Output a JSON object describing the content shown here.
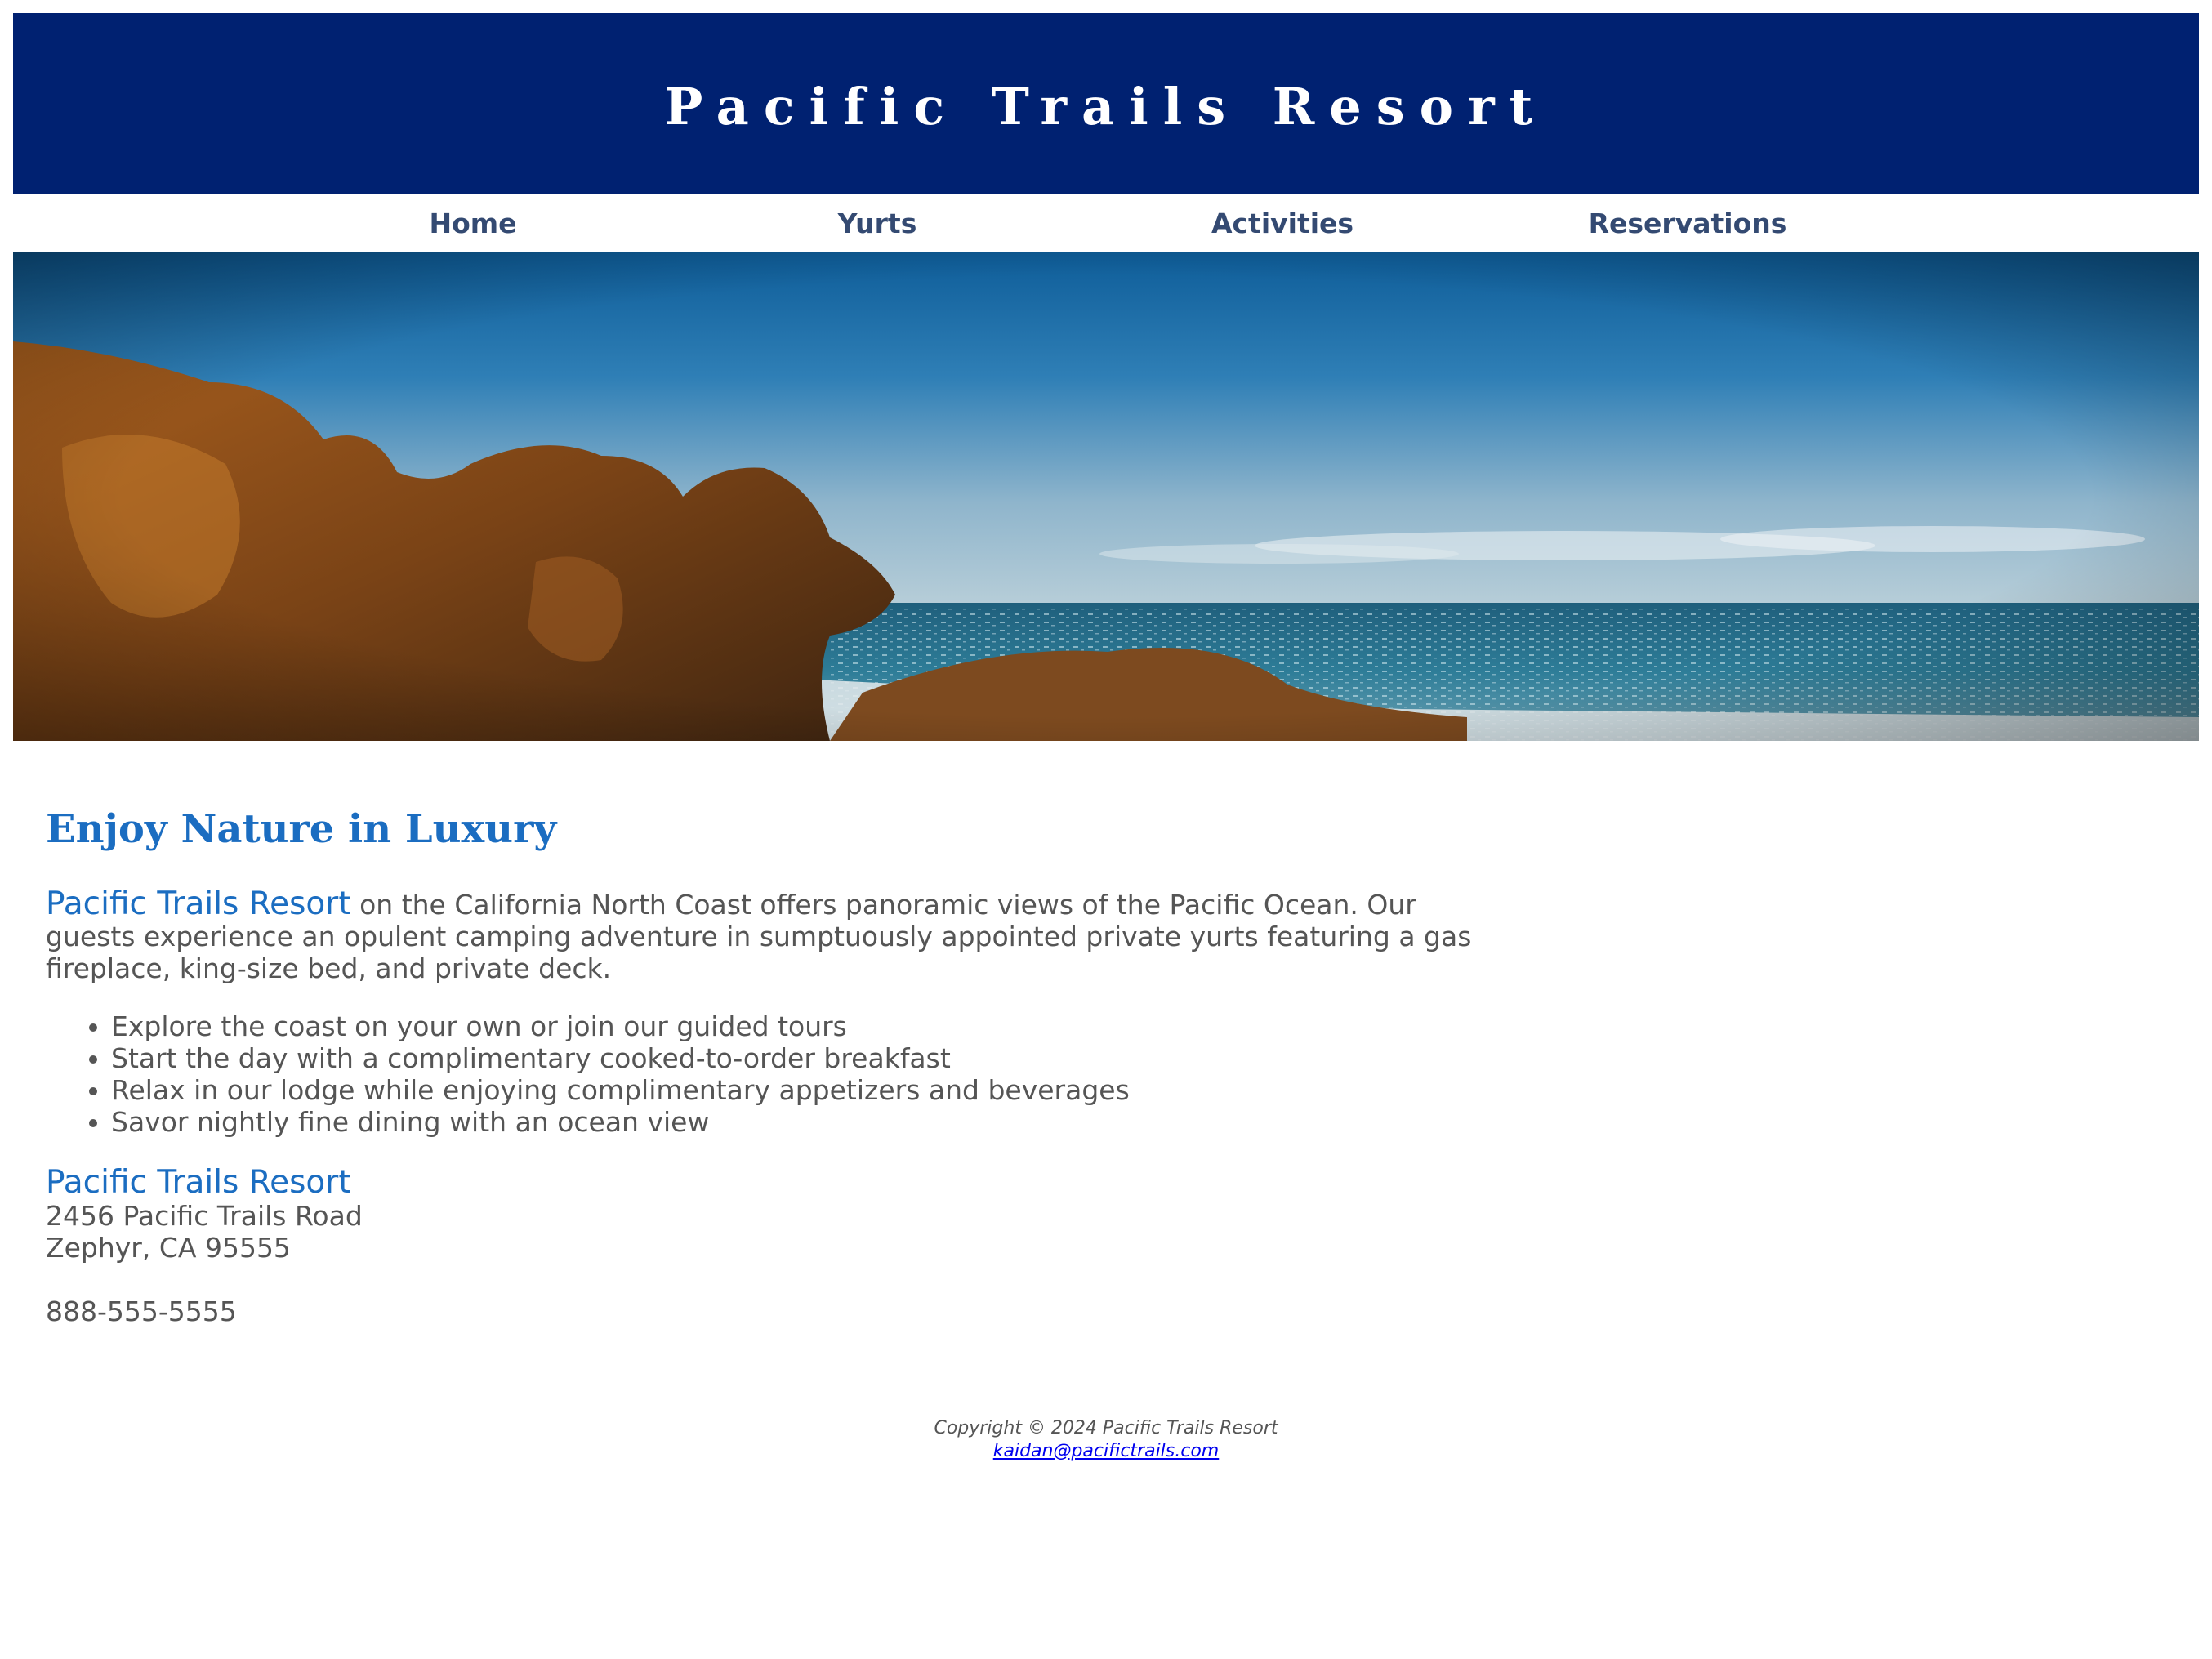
{
  "header": {
    "title": "Pacific Trails Resort"
  },
  "nav": {
    "items": [
      {
        "label": "Home"
      },
      {
        "label": "Yurts"
      },
      {
        "label": "Activities"
      },
      {
        "label": "Reservations"
      }
    ]
  },
  "colors": {
    "banner": "#002171",
    "accent": "#1b6dc1",
    "nav_text": "#344a72",
    "body_text": "#555555"
  },
  "main": {
    "headline": "Enjoy Nature in Luxury",
    "intro": {
      "resort_name": "Pacific Trails Resort",
      "text": " on the California North Coast offers panoramic views of the Pacific Ocean. Our guests experience an opulent camping adventure in sumptuously appointed private yurts featuring a gas fireplace, king-size bed, and private deck."
    },
    "features": [
      "Explore the coast on your own or join our guided tours",
      "Start the day with a complimentary cooked-to-order breakfast",
      "Relax in our lodge while enjoying complimentary appetizers and beverages",
      "Savor nightly fine dining with an ocean view"
    ],
    "contact": {
      "name": "Pacific Trails Resort",
      "street": "2456 Pacific Trails Road",
      "city": "Zephyr, CA 95555",
      "phone": "888-555-5555"
    }
  },
  "footer": {
    "copyright": "Copyright © 2024 Pacific Trails Resort",
    "email": "kaidan@pacifictrails.com"
  }
}
